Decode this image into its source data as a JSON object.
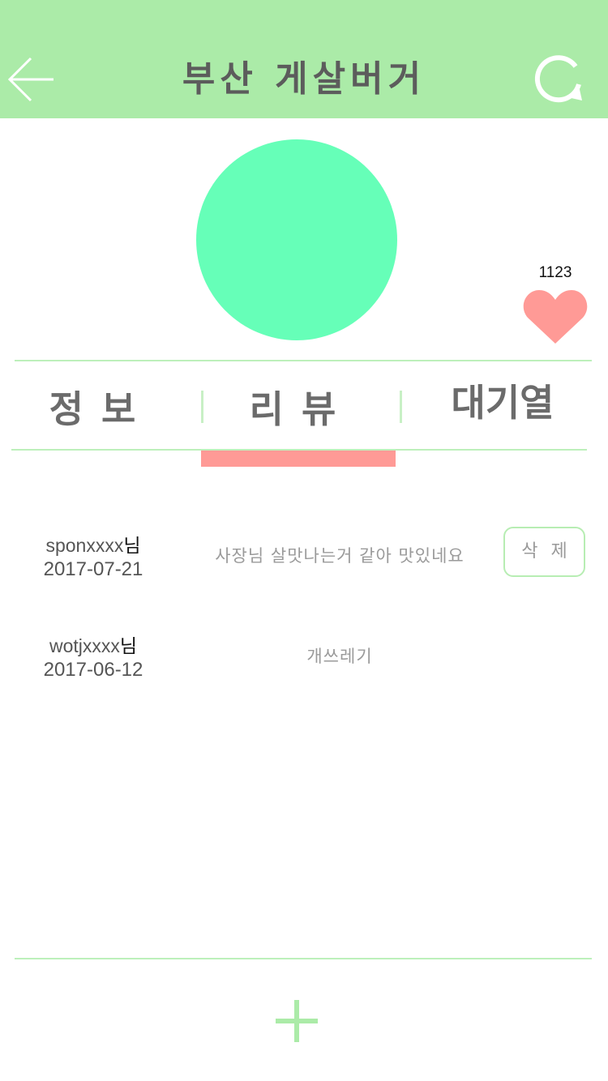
{
  "header": {
    "title": "부산 게살버거",
    "back_icon": "back-arrow-icon",
    "refresh_icon": "refresh-icon",
    "background": "#abeba8"
  },
  "store": {
    "avatar_color": "#66ffb8",
    "like_count": "1123",
    "like_icon": "heart-icon",
    "heart_color": "#ff9a96"
  },
  "tabs": [
    {
      "label": "정보"
    },
    {
      "label": "리뷰",
      "active": true
    },
    {
      "label": "대기열"
    }
  ],
  "reviews": [
    {
      "user": "sponxxxx",
      "suffix": "님",
      "date": "2017-07-21",
      "text": "사장님 살맛나는거 같아 맛있네요",
      "delete_label": "삭제"
    },
    {
      "user": "wotjxxxx",
      "suffix": "님",
      "date": "2017-06-12",
      "text": "개쓰레기"
    }
  ],
  "footer": {
    "add_icon": "plus-icon"
  }
}
